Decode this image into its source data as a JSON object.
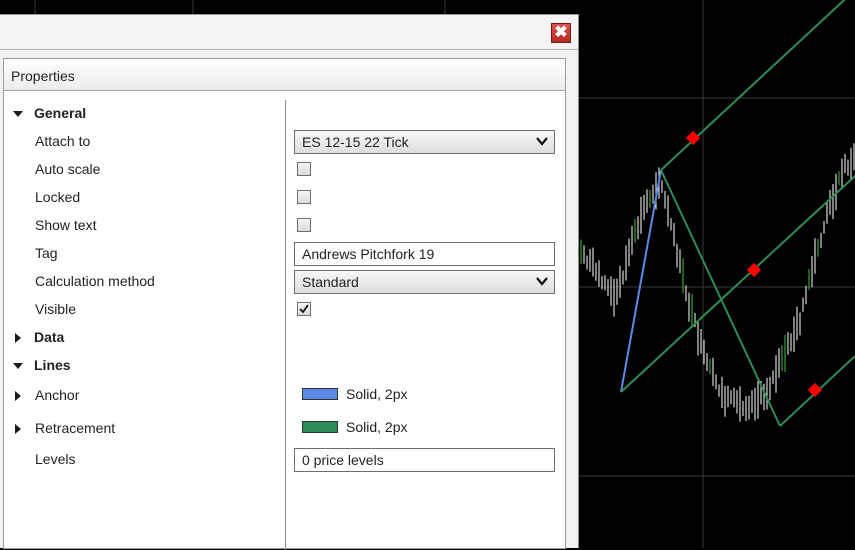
{
  "dialog": {
    "close_glyph": "✖",
    "panel_title": "Properties"
  },
  "groups": {
    "general": "General",
    "data": "Data",
    "lines": "Lines"
  },
  "general": {
    "attach_to": {
      "label": "Attach to",
      "value": "ES 12-15 22 Tick"
    },
    "auto_scale": {
      "label": "Auto scale",
      "checked": false
    },
    "locked": {
      "label": "Locked",
      "checked": false
    },
    "show_text": {
      "label": "Show text",
      "checked": false
    },
    "tag": {
      "label": "Tag",
      "value": "Andrews Pitchfork 19"
    },
    "calc_method": {
      "label": "Calculation method",
      "value": "Standard"
    },
    "visible": {
      "label": "Visible",
      "checked": true
    }
  },
  "lines": {
    "anchor": {
      "label": "Anchor",
      "style": "Solid, 2px",
      "color": "#5b8ae6"
    },
    "retracement": {
      "label": "Retracement",
      "style": "Solid, 2px",
      "color": "#2e8b57"
    },
    "levels": {
      "label": "Levels",
      "value": "0 price levels"
    }
  },
  "colors": {
    "chart_bg": "#000000",
    "grid": "#3a3a3a",
    "bars": "#ffffff",
    "bars_accent": "#3cc43c",
    "pitchfork": "#2e8b57",
    "anchor": "#5b8ae6",
    "handle": "#ff0000"
  }
}
